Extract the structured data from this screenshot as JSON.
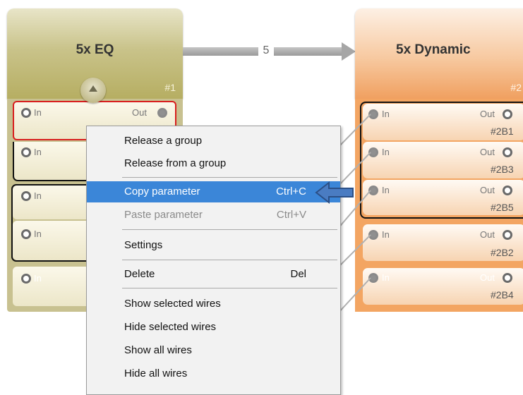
{
  "eq_block": {
    "title": "5x EQ",
    "number": "#1",
    "ports": [
      {
        "in": "In",
        "out": "Out"
      },
      {
        "in": "In"
      },
      {
        "in": "In"
      },
      {
        "in": "In"
      },
      {
        "in": "In"
      }
    ]
  },
  "connection": {
    "count": "5"
  },
  "dynamic_block": {
    "title": "5x Dynamic",
    "number": "#2",
    "channels": [
      {
        "in": "In",
        "out": "Out",
        "id": "#2B1"
      },
      {
        "in": "In",
        "out": "Out",
        "id": "#2B3"
      },
      {
        "in": "In",
        "out": "Out",
        "id": "#2B5"
      },
      {
        "in": "In",
        "out": "Out",
        "id": "#2B2"
      },
      {
        "in": "In",
        "out": "Out",
        "id": "#2B4"
      }
    ]
  },
  "context_menu": {
    "items": [
      {
        "label": "Release a group",
        "shortcut": ""
      },
      {
        "label": "Release from a group",
        "shortcut": ""
      },
      {
        "label": "Copy parameter",
        "shortcut": "Ctrl+C",
        "highlighted": true
      },
      {
        "label": "Paste parameter",
        "shortcut": "Ctrl+V",
        "disabled": true
      },
      {
        "label": "Settings",
        "shortcut": ""
      },
      {
        "label": "Delete",
        "shortcut": "Del"
      },
      {
        "label": "Show selected wires",
        "shortcut": ""
      },
      {
        "label": "Hide selected wires",
        "shortcut": ""
      },
      {
        "label": "Show all wires",
        "shortcut": ""
      },
      {
        "label": "Hide all wires",
        "shortcut": ""
      }
    ]
  },
  "colors": {
    "eq_block": "#c8c190",
    "dynamic_block": "#f3a562",
    "menu_highlight": "#3b86d8",
    "pointer_arrow": "#3d6fb5",
    "selected_border": "#d81e1e"
  },
  "icons": [
    "collapse-up-icon",
    "blue-left-arrow-icon"
  ]
}
